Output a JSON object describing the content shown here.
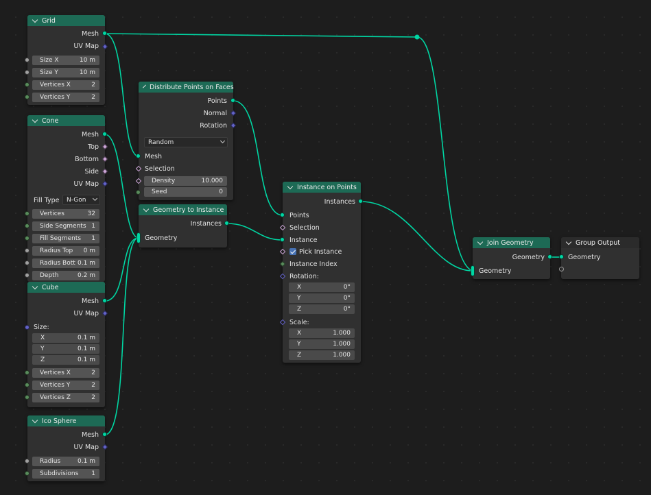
{
  "nodes": {
    "grid": {
      "title": "Grid",
      "outputs": [
        "Mesh",
        "UV Map"
      ],
      "fields": [
        {
          "label": "Size X",
          "value": "10 m"
        },
        {
          "label": "Size Y",
          "value": "10 m"
        },
        {
          "label": "Vertices X",
          "value": "2"
        },
        {
          "label": "Vertices Y",
          "value": "2"
        }
      ]
    },
    "cone": {
      "title": "Cone",
      "outputs": [
        "Mesh",
        "Top",
        "Bottom",
        "Side",
        "UV Map"
      ],
      "fill_type_label": "Fill Type",
      "fill_type_value": "N-Gon",
      "fields": [
        {
          "label": "Vertices",
          "value": "32"
        },
        {
          "label": "Side Segments",
          "value": "1"
        },
        {
          "label": "Fill Segments",
          "value": "1"
        },
        {
          "label": "Radius Top",
          "value": "0 m"
        },
        {
          "label": "Radius Bott",
          "value": "0.1 m"
        },
        {
          "label": "Depth",
          "value": "0.2 m"
        }
      ]
    },
    "cube": {
      "title": "Cube",
      "outputs": [
        "Mesh",
        "UV Map"
      ],
      "size_label": "Size:",
      "size": [
        {
          "label": "X",
          "value": "0.1 m"
        },
        {
          "label": "Y",
          "value": "0.1 m"
        },
        {
          "label": "Z",
          "value": "0.1 m"
        }
      ],
      "fields": [
        {
          "label": "Vertices X",
          "value": "2"
        },
        {
          "label": "Vertices Y",
          "value": "2"
        },
        {
          "label": "Vertices Z",
          "value": "2"
        }
      ]
    },
    "ico": {
      "title": "Ico Sphere",
      "outputs": [
        "Mesh",
        "UV Map"
      ],
      "fields": [
        {
          "label": "Radius",
          "value": "0.1 m"
        },
        {
          "label": "Subdivisions",
          "value": "1"
        }
      ]
    },
    "distribute": {
      "title": "Distribute Points on Faces",
      "outputs": [
        "Points",
        "Normal",
        "Rotation"
      ],
      "mode": "Random",
      "inputs": [
        "Mesh",
        "Selection"
      ],
      "fields": [
        {
          "label": "Density",
          "value": "10.000"
        },
        {
          "label": "Seed",
          "value": "0"
        }
      ]
    },
    "geo_to_inst": {
      "title": "Geometry to Instance",
      "outputs": [
        "Instances"
      ],
      "inputs": [
        "Geometry"
      ]
    },
    "inst_on_points": {
      "title": "Instance on Points",
      "outputs": [
        "Instances"
      ],
      "inputs": [
        "Points",
        "Selection",
        "Instance"
      ],
      "pick_instance": "Pick Instance",
      "instance_index": "Instance Index",
      "rotation_label": "Rotation:",
      "rotation": [
        {
          "label": "X",
          "value": "0°"
        },
        {
          "label": "Y",
          "value": "0°"
        },
        {
          "label": "Z",
          "value": "0°"
        }
      ],
      "scale_label": "Scale:",
      "scale": [
        {
          "label": "X",
          "value": "1.000"
        },
        {
          "label": "Y",
          "value": "1.000"
        },
        {
          "label": "Z",
          "value": "1.000"
        }
      ]
    },
    "join": {
      "title": "Join Geometry",
      "outputs": [
        "Geometry"
      ],
      "inputs": [
        "Geometry"
      ]
    },
    "group_output": {
      "title": "Group Output",
      "inputs": [
        "Geometry"
      ]
    }
  },
  "colors": {
    "geometry_socket": "#00d6a3",
    "vector_socket": "#6363c7",
    "bool_socket": "#cca6d6",
    "float_socket": "#a1a1a1",
    "int_socket": "#598c5c",
    "node_header": "#1d6a55",
    "link": "#00d6a3"
  }
}
